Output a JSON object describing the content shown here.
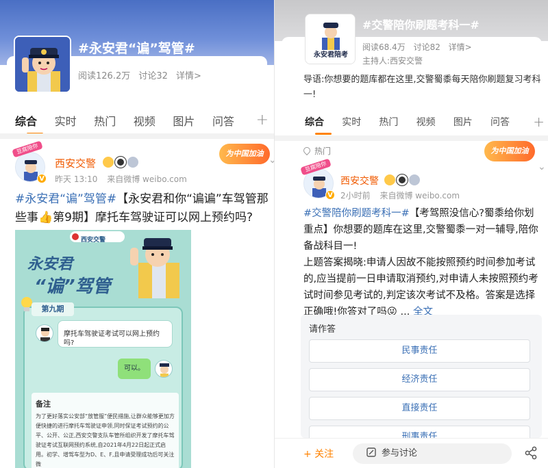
{
  "left": {
    "topic": {
      "title": "#永安君“谝”驾管#",
      "reads": "阅读126.2万",
      "discussions": "讨论32",
      "details": "详情>"
    },
    "tabs": [
      "综合",
      "实时",
      "热门",
      "视频",
      "图片",
      "问答"
    ],
    "post": {
      "author": "西安交警",
      "time": "昨天 13:10",
      "source": "来自微博 weibo.com",
      "badge": "为中国加油",
      "avatar_banner": "豆腐陪你",
      "text_tag": "#永安君“谝”驾管#",
      "text_body": "【永安君和你“谝谝”车驾管那些事👍第9期】摩托车驾驶证可以网上预约吗?"
    },
    "poster": {
      "org": "西安交警",
      "title_line1": "永安君",
      "title_line2": "“谝”驾管",
      "issue": "第九期",
      "question": "摩托车驾驶证考试可以网上预约吗?",
      "answer": "可以。",
      "note_title": "备注",
      "note_body": "为了更好落实公安部“放管服”便民措施,让群众能够更加方便快捷的进行摩托车驾驶证申领,同时保证考试预约的公平、公开、公正,西安交警支队车管所组织开发了摩托车驾驶证考试互联网预约系统,自2021年4月22日起正式启用。初学、增驾车型为D、E、F,且申请受理成功后可关注微"
    }
  },
  "right": {
    "topic": {
      "title": "#交警陪你刷题考科一#",
      "reads": "阅读68.4万",
      "discussions": "讨论82",
      "details": "详情>",
      "host": "主持人:西安交警",
      "avatar_text": "永安君陪考",
      "intro": "导语:你想要的题库都在这里,交警蜀黍每天陪你刷题复习考科一!"
    },
    "tabs": [
      "综合",
      "实时",
      "热门",
      "视频",
      "图片",
      "问答"
    ],
    "hot_label": "热门",
    "post": {
      "author": "西安交警",
      "time": "2小时前",
      "source": "来自微博 weibo.com",
      "badge": "为中国加油",
      "avatar_banner": "豆腐陪你",
      "text_tag": "#交警陪你刷题考科一#",
      "text_body": "【考驾照没信心?蜀黍给你划重点】你想要的题库在这里,交警蜀黍一对一辅导,陪你备战科目一!",
      "text_answer": "上题答案揭晓:申请人因故不能按照预约时间参加考试的,应当提前一日申请取消预约,对申请人未按照预约考试时间参见考试的,判定该次考试不及格。答案是选择正确哦!你答对了吗😜 ...",
      "full_text": "全文"
    },
    "quiz": {
      "title": "请作答",
      "options": [
        "民事责任",
        "经济责任",
        "直接责任",
        "刑事责任"
      ]
    },
    "bottom": {
      "follow": "+ 关注",
      "discuss": "参与讨论"
    }
  },
  "colors": {
    "accent": "#ff8200",
    "link": "#3a6fb5",
    "author": "#f05a00"
  }
}
